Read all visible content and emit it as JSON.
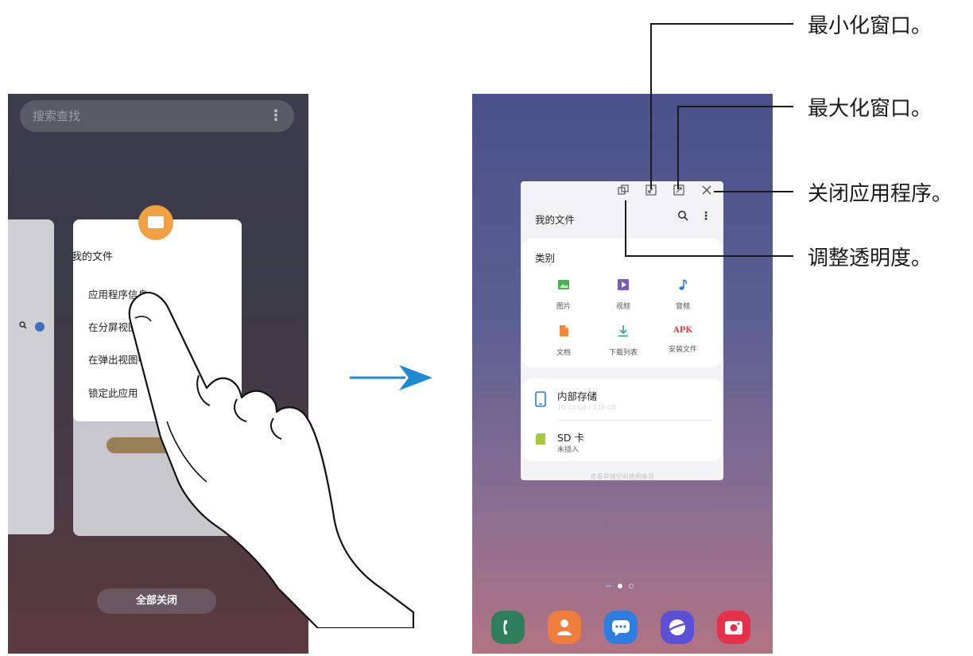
{
  "left_screen": {
    "search_placeholder": "搜索查找",
    "menu_icon": "⋮",
    "popup": {
      "app_name": "我的文件",
      "items": [
        "应用程序信息",
        "在分屏视图中打开",
        "在弹出视图中打开",
        "锁定此应用"
      ]
    },
    "close_all_label": "全部关闭"
  },
  "right_screen": {
    "window_title": "我的文件",
    "categories_label": "类别",
    "categories": [
      {
        "label": "图片",
        "icon": "image-icon",
        "color": "#4caf50"
      },
      {
        "label": "视频",
        "icon": "video-icon",
        "color": "#7e57c2"
      },
      {
        "label": "音频",
        "icon": "music-icon",
        "color": "#2979d8"
      },
      {
        "label": "文档",
        "icon": "document-icon",
        "color": "#f08a3a"
      },
      {
        "label": "下载列表",
        "icon": "download-icon",
        "color": "#26a69a"
      },
      {
        "label": "安装文件",
        "icon": "apk-icon",
        "color": "#e53935",
        "glyph": "APK"
      }
    ],
    "storage": [
      {
        "name": "内部存储",
        "detail": "20.23 GB / 128 GB",
        "icon": "phone-storage-icon"
      },
      {
        "name": "SD 卡",
        "detail": "未插入",
        "icon": "sd-card-icon"
      }
    ],
    "footer": "查看存储空间使用情况",
    "dock": [
      {
        "icon": "phone-icon",
        "color": "#2e7d5b"
      },
      {
        "icon": "contacts-icon",
        "color": "#ef7d3c"
      },
      {
        "icon": "messages-icon",
        "color": "#2f7de0"
      },
      {
        "icon": "internet-icon",
        "color": "#5b4fd8"
      },
      {
        "icon": "camera-icon",
        "color": "#e3324a"
      }
    ]
  },
  "callouts": {
    "minimize": "最小化窗口。",
    "maximize": "最大化窗口。",
    "close": "关闭应用程序。",
    "opacity": "调整透明度。"
  },
  "colors": {
    "arrow": "#1b8ad3"
  }
}
